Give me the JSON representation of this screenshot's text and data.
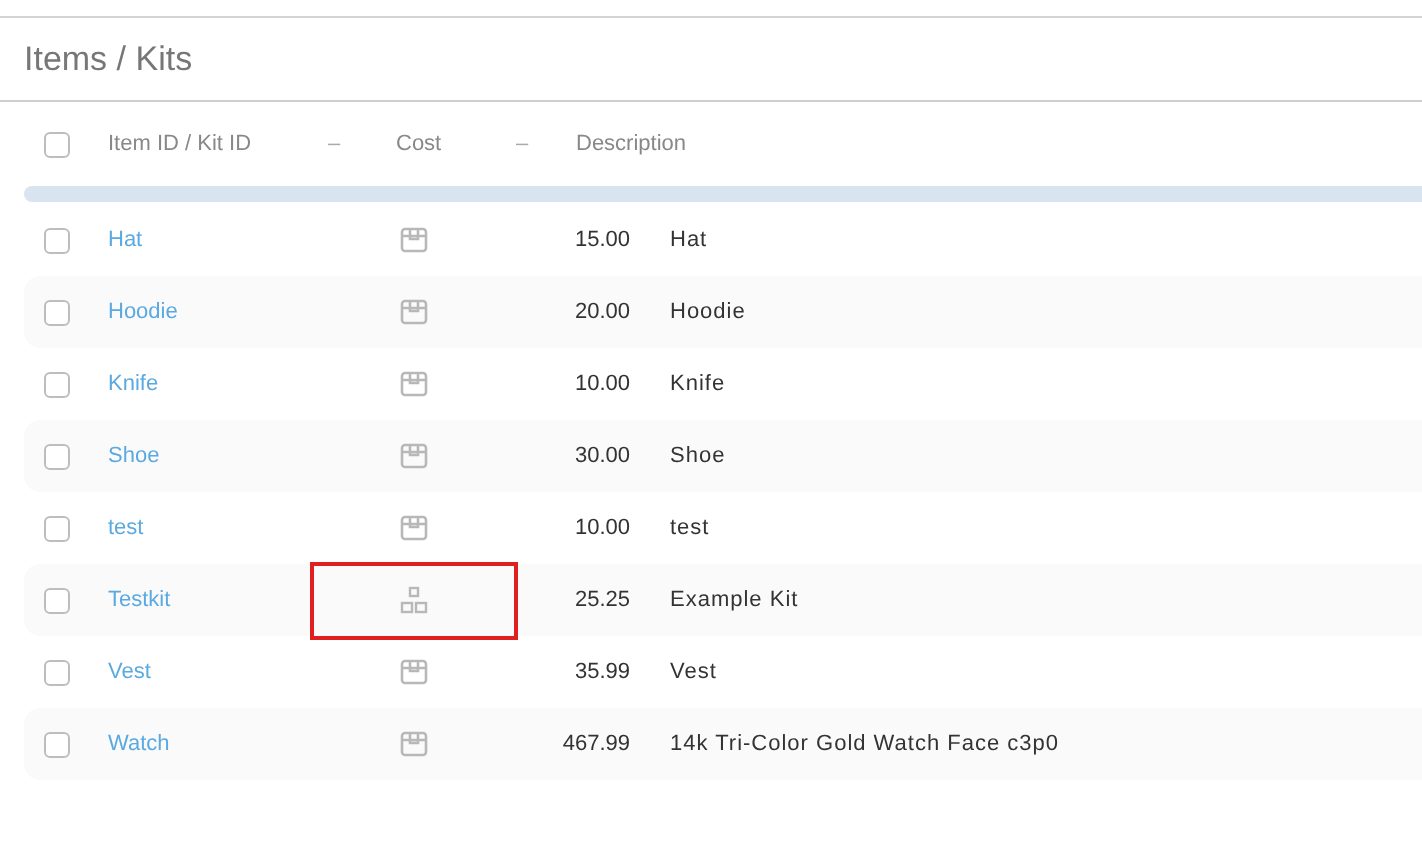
{
  "title": "Items / Kits",
  "select_all": {
    "checked": false
  },
  "columns": [
    {
      "label": "Item ID / Kit ID",
      "kind": "text"
    },
    {
      "label": "–",
      "kind": "sort"
    },
    {
      "label": "Cost",
      "kind": "text"
    },
    {
      "label": "–",
      "kind": "sort"
    },
    {
      "label": "Description",
      "kind": "text"
    }
  ],
  "rows": [
    {
      "id": "Hat",
      "kind": "item",
      "cost": "15.00",
      "description": "Hat",
      "checked": false,
      "highlighted": false
    },
    {
      "id": "Hoodie",
      "kind": "item",
      "cost": "20.00",
      "description": "Hoodie",
      "checked": false,
      "highlighted": false
    },
    {
      "id": "Knife",
      "kind": "item",
      "cost": "10.00",
      "description": "Knife",
      "checked": false,
      "highlighted": false
    },
    {
      "id": "Shoe",
      "kind": "item",
      "cost": "30.00",
      "description": "Shoe",
      "checked": false,
      "highlighted": false
    },
    {
      "id": "test",
      "kind": "item",
      "cost": "10.00",
      "description": "test",
      "checked": false,
      "highlighted": false
    },
    {
      "id": "Testkit",
      "kind": "kit",
      "cost": "25.25",
      "description": "Example Kit",
      "checked": false,
      "highlighted": true
    },
    {
      "id": "Vest",
      "kind": "item",
      "cost": "35.99",
      "description": "Vest",
      "checked": false,
      "highlighted": false
    },
    {
      "id": "Watch",
      "kind": "item",
      "cost": "467.99",
      "description": "14k Tri-Color Gold Watch Face c3p0",
      "checked": false,
      "highlighted": false
    }
  ]
}
